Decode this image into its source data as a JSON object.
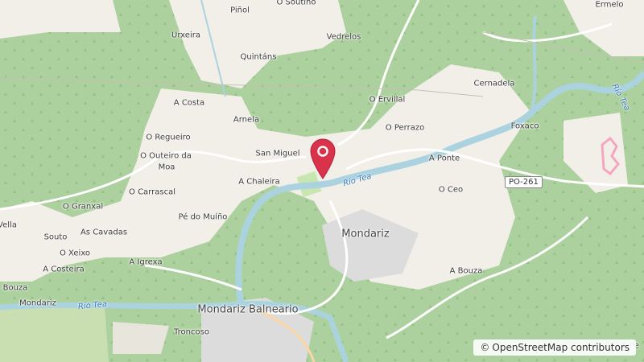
{
  "map": {
    "places": {
      "pinol": "Piñol",
      "o_soutino": "O Soutiño",
      "ermelo": "Ermelo",
      "urxeira": "Urxeira",
      "vedrelos": "Vedrelos",
      "quintans": "Quintáns",
      "a_costa": "A Costa",
      "o_ervillal": "O Ervillal",
      "cernadela": "Cernadela",
      "arnela": "Arnela",
      "o_regueiro": "O Regueiro",
      "o_perrazo": "O Perrazo",
      "foxaco": "Foxaco",
      "o_outeiro_da_moa_1": "O Outeiro da",
      "o_outeiro_da_moa_2": "Moa",
      "san_miguel": "San Miguel",
      "a_ponte": "A Ponte",
      "a_chaleira": "A Chaleira",
      "o_carrascal": "O Carrascal",
      "o_ceo": "O Ceo",
      "o_granxal": "O Granxal",
      "pe_do_muino": "Pé do Muíño",
      "vella": "Vella",
      "souto": "Souto",
      "as_cavadas": "As Cavadas",
      "mondariz": "Mondariz",
      "o_xeixo": "O Xeixo",
      "a_igrexa": "A Igrexa",
      "a_costeira": "A Costeira",
      "a_bouza": "A Bouza",
      "bouza": "Bouza",
      "mondariz_balneario": "Mondariz Balneario",
      "troncoso": "Troncoso",
      "mondariz_small": "Mondariz",
      "a_pe": "A Pe"
    },
    "rivers": {
      "tea_1": "Río Tea",
      "tea_2": "Río Tea",
      "tea_3": "Río Tea"
    },
    "road_shield": "PO-261",
    "attribution": {
      "symbol": "©",
      "text": "OpenStreetMap contributors"
    },
    "colors": {
      "forest": "#add19e",
      "land": "#f2efe9",
      "residential": "#e0dfdf",
      "water": "#aad3df",
      "river_line": "#7fb7cc",
      "pin": "#d8334a"
    }
  }
}
